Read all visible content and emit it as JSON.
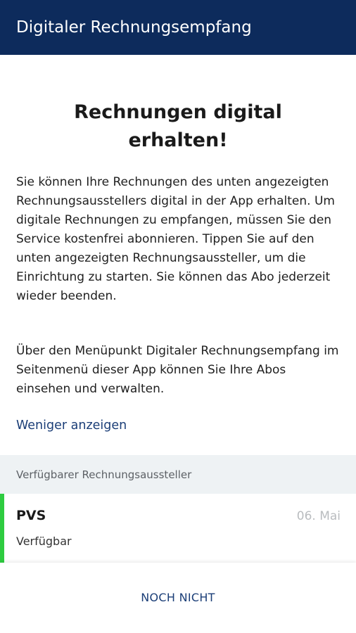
{
  "app_bar": {
    "title": "Digitaler Rechnungsempfang"
  },
  "main": {
    "headline_line1": "Rechnungen digital",
    "headline_line2": "erhalten!",
    "paragraph1": "Sie können Ihre Rechnungen des unten angezeigten Rechnungsausstellers digital in der App erhalten. Um digitale Rechnungen zu empfangen, müssen Sie den Service kostenfrei abonnieren. Tippen Sie auf den unten angezeigten Rechnungsaussteller, um die Einrichtung zu starten. Sie können das Abo jederzeit wieder beenden.",
    "paragraph2": "Über den Menüpunkt Digitaler Rechnungsempfang im Seitenmenü dieser App können Sie Ihre Abos einsehen und verwalten.",
    "show_less_link": "Weniger anzeigen"
  },
  "issuers": {
    "section_title": "Verfügbarer Rechnungsaussteller",
    "items": [
      {
        "name": "PVS",
        "date": "06. Mai",
        "status": "Verfügbar"
      }
    ]
  },
  "footer": {
    "not_now_label": "NOCH NICHT"
  },
  "colors": {
    "app_bar_bg": "#0d2b5c",
    "link": "#1b3e77",
    "accent_available": "#2ecc40",
    "section_bg": "#eef2f4"
  }
}
